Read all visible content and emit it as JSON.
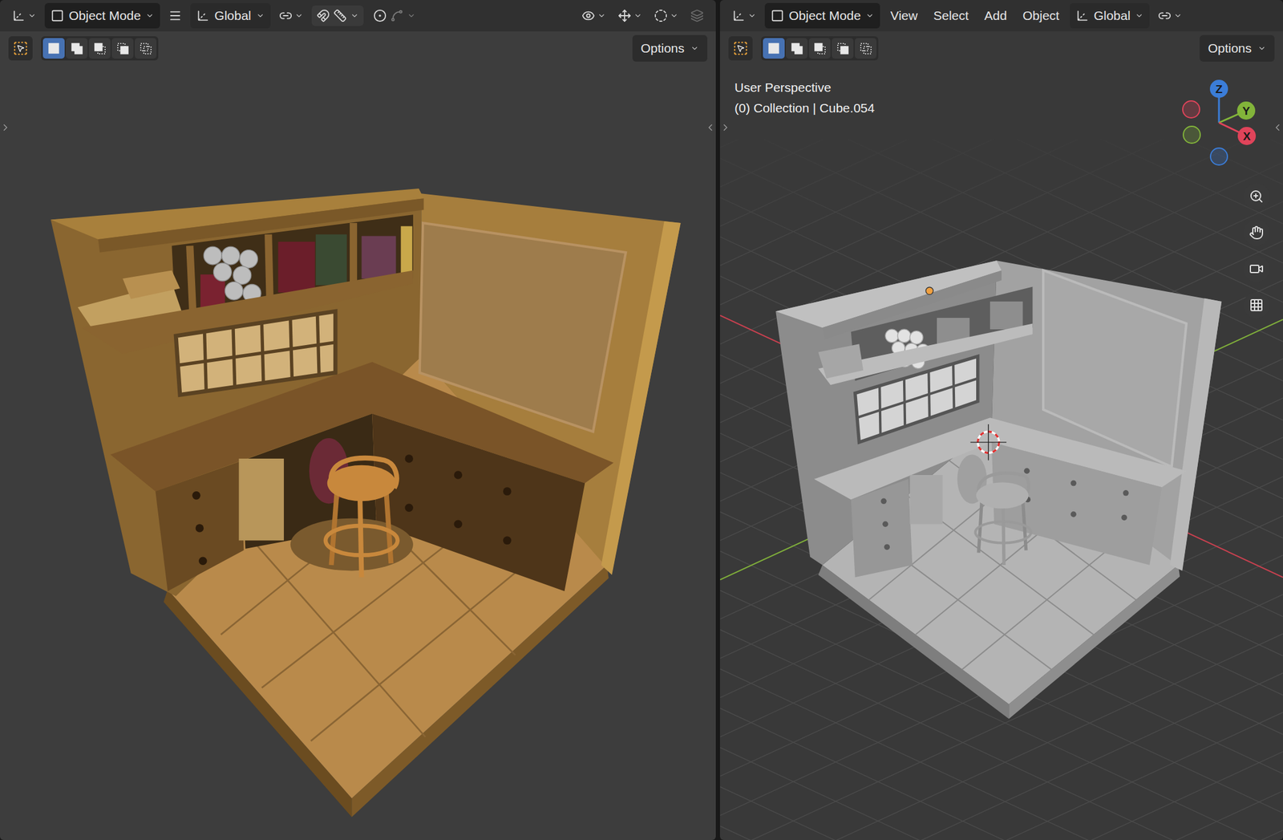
{
  "viewports": [
    {
      "kind": "rendered",
      "mode": "Object Mode",
      "menus": [],
      "orientation": "Global",
      "options": "Options",
      "select_modes": [
        {
          "selected": true
        },
        {
          "selected": false
        },
        {
          "selected": false
        },
        {
          "selected": false
        },
        {
          "selected": false
        }
      ],
      "overlay_lines": [],
      "gizmo": []
    },
    {
      "kind": "solid",
      "mode": "Object Mode",
      "menus": [
        "View",
        "Select",
        "Add",
        "Object"
      ],
      "orientation": "Global",
      "options": "Options",
      "select_modes": [
        {
          "selected": true
        },
        {
          "selected": false
        },
        {
          "selected": false
        },
        {
          "selected": false
        },
        {
          "selected": false
        }
      ],
      "overlay_lines": [
        "User Perspective",
        "(0) Collection | Cube.054"
      ],
      "gizmo": [
        {
          "label": "Z",
          "color": "#3b7dd8"
        },
        {
          "label": "Y",
          "color": "#82b43a"
        },
        {
          "label": "X",
          "color": "#e0445a"
        }
      ]
    }
  ]
}
